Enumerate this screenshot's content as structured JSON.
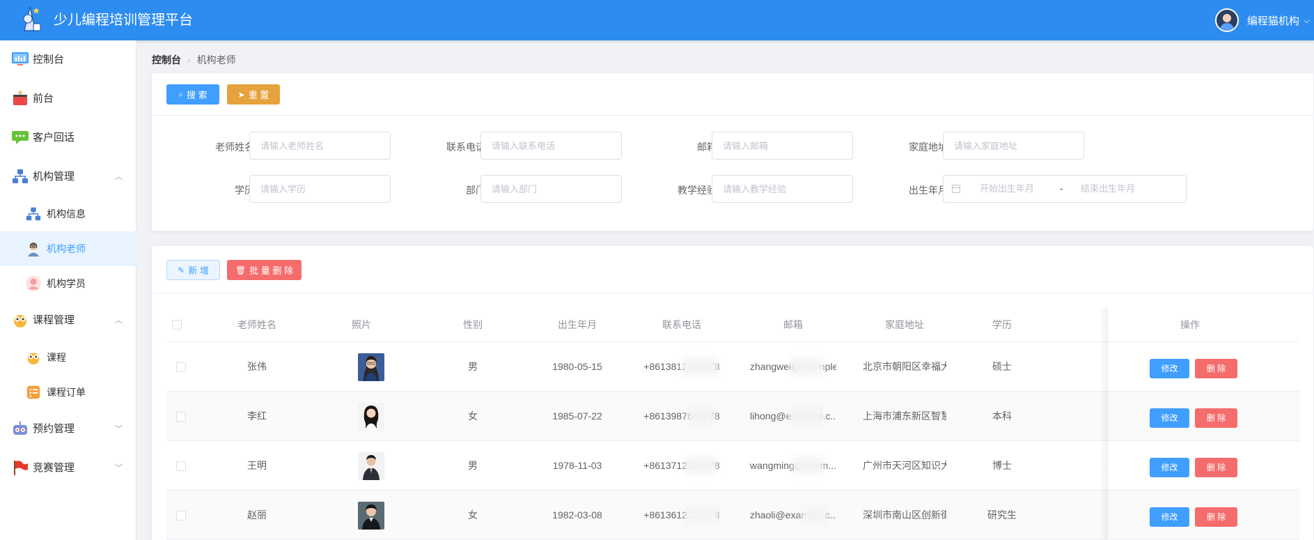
{
  "app": {
    "title": "少儿编程培训管理平台",
    "logo_icon": "rocket-logo",
    "user_name": "编程猫机构",
    "accent": "#2d8cf0"
  },
  "sidebar": {
    "items": [
      {
        "label": "控制台",
        "icon": "monitor-icon"
      },
      {
        "label": "前台",
        "icon": "reception-icon"
      },
      {
        "label": "客户回话",
        "icon": "chat-bubble-icon"
      },
      {
        "label": "机构管理",
        "icon": "org-chart-icon"
      },
      {
        "label": "课程管理",
        "icon": "owl-icon"
      },
      {
        "label": "预约管理",
        "icon": "robot-icon"
      },
      {
        "label": "竞赛管理",
        "icon": "flag-icon"
      }
    ],
    "org_sub": [
      {
        "label": "机构信息",
        "icon": "org-chart-icon"
      },
      {
        "label": "机构老师",
        "icon": "teacher-icon"
      },
      {
        "label": "机构学员",
        "icon": "student-icon"
      }
    ],
    "course_sub": [
      {
        "label": "课程",
        "icon": "owl-icon"
      },
      {
        "label": "课程订单",
        "icon": "order-list-icon"
      }
    ]
  },
  "breadcrumb": {
    "home": "控制台",
    "current": "机构老师"
  },
  "search": {
    "search_btn": "搜 索",
    "reset_btn": "重 置",
    "fields": {
      "name": {
        "label": "老师姓名",
        "placeholder": "请输入老师姓名"
      },
      "phone": {
        "label": "联系电话",
        "placeholder": "请输入联系电话"
      },
      "email": {
        "label": "邮箱",
        "placeholder": "请输入邮箱"
      },
      "address": {
        "label": "家庭地址",
        "placeholder": "请输入家庭地址"
      },
      "edu": {
        "label": "学历",
        "placeholder": "请输入学历"
      },
      "dept": {
        "label": "部门",
        "placeholder": "请输入部门"
      },
      "exp": {
        "label": "教学经验",
        "placeholder": "请输入教学经验"
      },
      "birth": {
        "label": "出生年月",
        "start": "开始出生年月",
        "sep": "-",
        "end": "结束出生年月"
      }
    }
  },
  "actions": {
    "add": "新 增",
    "batch_delete": "批 量 删 除"
  },
  "table": {
    "headers": {
      "name": "老师姓名",
      "photo": "照片",
      "gender": "性别",
      "birth": "出生年月",
      "phone": "联系电话",
      "email": "邮箱",
      "address": "家庭地址",
      "edu": "学历",
      "ops": "操作"
    },
    "edit_label": "修改",
    "delete_label": "删 除",
    "rows": [
      {
        "name": "张伟",
        "gender": "男",
        "birth": "1980-05-15",
        "phone": "+8613812345678",
        "email": "zhangwei@example...",
        "address": "北京市朝阳区幸福大...",
        "edu": "硕士"
      },
      {
        "name": "李红",
        "gender": "女",
        "birth": "1985-07-22",
        "phone": "+8613987645678",
        "email": "lihong@example.c...",
        "address": "上海市浦东新区智慧...",
        "edu": "本科"
      },
      {
        "name": "王明",
        "gender": "男",
        "birth": "1978-11-03",
        "phone": "+8613712345678",
        "email": "wangming@exam...",
        "address": "广州市天河区知识大...",
        "edu": "博士"
      },
      {
        "name": "赵丽",
        "gender": "女",
        "birth": "1982-03-08",
        "phone": "+8613612345678",
        "email": "zhaoli@example.c...",
        "address": "深圳市南山区创新街...",
        "edu": "研究生"
      }
    ]
  }
}
